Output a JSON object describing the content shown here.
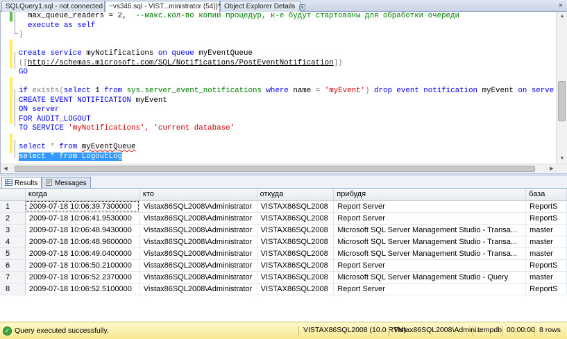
{
  "tabs": [
    {
      "label": "SQLQuery1.sql - not connected",
      "active": false
    },
    {
      "label": "~vs346.sql - VIST...ministrator (54))*",
      "active": true
    },
    {
      "label": "Object Explorer Details",
      "active": false
    }
  ],
  "editor": {
    "lines": {
      "l1a": "max_queue_readers = 2,",
      "l1b": "--макс.кол-во копий процедур, к-е будут стартованы для обработки очереди",
      "l2a": "execute",
      "l2b": "as self",
      "l3": ")",
      "l4a": "create service",
      "l4b": "myNotifications",
      "l4c": "on queue",
      "l4d": "myEventQueue",
      "l5a": "([",
      "l5b": "http://schemas.microsoft.com/SQL/Notifications/PostEventNotification",
      "l5c": "])",
      "l6": "GO",
      "l7a": "if",
      "l7b": "exists",
      "l7c": "(",
      "l7d": "select",
      "l7e": "1",
      "l7f": "from",
      "l7g": "sys.server_event_notifications",
      "l7h": "where",
      "l7i": "name",
      "l7j": "=",
      "l7k": "'myEvent'",
      "l7l": ")",
      "l7m": "drop event notification",
      "l7n": "myEvent",
      "l7o": "on server",
      "l8a": "CREATE EVENT NOTIFICATION",
      "l8b": "myEvent",
      "l9": "ON server",
      "l10": "FOR AUDIT_LOGOUT",
      "l11a": "TO SERVICE",
      "l11b": "'myNotifications',",
      "l11c": "'current database'",
      "l12a": "select",
      "l12b": "*",
      "l12c": "from",
      "l12d": "myEventQueue",
      "l13a": "select",
      "l13b": "* from LogoutLog"
    }
  },
  "results": {
    "tabs": [
      {
        "label": "Results",
        "icon": "grid-icon",
        "active": true
      },
      {
        "label": "Messages",
        "icon": "messages-icon",
        "active": false
      }
    ],
    "columns": [
      "когда",
      "кто",
      "откуда",
      "прибудя",
      "база"
    ],
    "rows": [
      [
        "1",
        "2009-07-18 10:06:39.7300000",
        "Vistax86SQL2008\\Administrator",
        "VISTAX86SQL2008",
        "Report Server",
        "ReportS"
      ],
      [
        "2",
        "2009-07-18 10:06:41.9530000",
        "Vistax86SQL2008\\Administrator",
        "VISTAX86SQL2008",
        "Report Server",
        "ReportS"
      ],
      [
        "3",
        "2009-07-18 10:06:48.9430000",
        "Vistax86SQL2008\\Administrator",
        "VISTAX86SQL2008",
        "Microsoft SQL Server Management Studio - Transa...",
        "master"
      ],
      [
        "4",
        "2009-07-18 10:06:48.9600000",
        "Vistax86SQL2008\\Administrator",
        "VISTAX86SQL2008",
        "Microsoft SQL Server Management Studio - Transa...",
        "master"
      ],
      [
        "5",
        "2009-07-18 10:06:49.0400000",
        "Vistax86SQL2008\\Administrator",
        "VISTAX86SQL2008",
        "Microsoft SQL Server Management Studio - Transa...",
        "master"
      ],
      [
        "6",
        "2009-07-18 10:06:50.2100000",
        "Vistax86SQL2008\\Administrator",
        "VISTAX86SQL2008",
        "Report Server",
        "ReportS"
      ],
      [
        "7",
        "2009-07-18 10:06:52.2370000",
        "Vistax86SQL2008\\Administrator",
        "VISTAX86SQL2008",
        "Microsoft SQL Server Management Studio - Query",
        "master"
      ],
      [
        "8",
        "2009-07-18 10:06:52.5100000",
        "Vistax86SQL2008\\Administrator",
        "VISTAX86SQL2008",
        "Report Server",
        "ReportS"
      ]
    ]
  },
  "status": {
    "message": "Query executed successfully.",
    "server": "VISTAX86SQL2008 (10.0 RTM)",
    "user": "Vistax86SQL2008\\Admini...",
    "database": "tempdb",
    "elapsed": "00:00:00",
    "row_count": "8 rows"
  },
  "colors": {
    "keyword": "#0000ff",
    "string": "#d00000",
    "comment": "#008000",
    "selection": "#3399ff",
    "status_bar": "#f7e88f"
  }
}
